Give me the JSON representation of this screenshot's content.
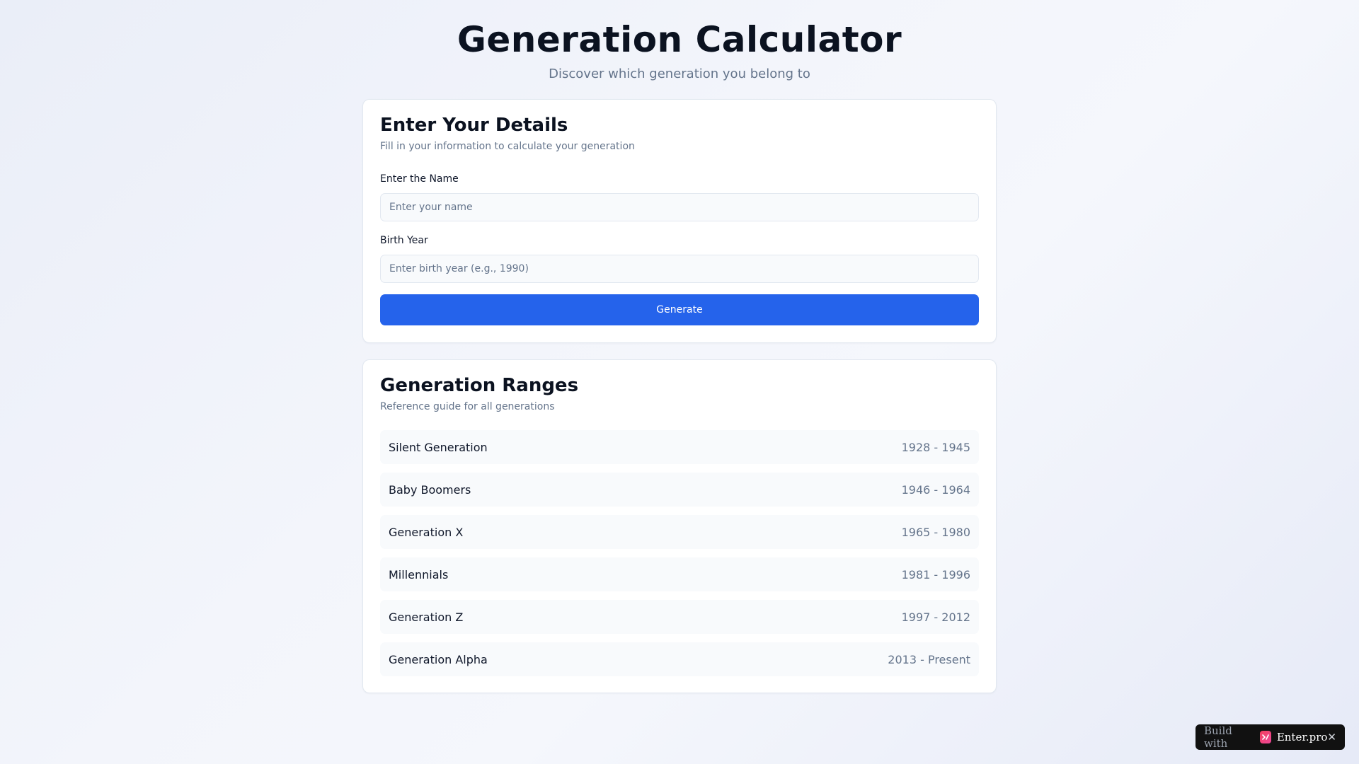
{
  "header": {
    "title": "Generation Calculator",
    "subtitle": "Discover which generation you belong to"
  },
  "details_card": {
    "title": "Enter Your Details",
    "description": "Fill in your information to calculate your generation",
    "name_label": "Enter the Name",
    "name_placeholder": "Enter your name",
    "name_value": "",
    "year_label": "Birth Year",
    "year_placeholder": "Enter birth year (e.g., 1990)",
    "year_value": "",
    "button_label": "Generate"
  },
  "ranges_card": {
    "title": "Generation Ranges",
    "description": "Reference guide for all generations",
    "items": [
      {
        "name": "Silent Generation",
        "years": "1928 - 1945"
      },
      {
        "name": "Baby Boomers",
        "years": "1946 - 1964"
      },
      {
        "name": "Generation X",
        "years": "1965 - 1980"
      },
      {
        "name": "Millennials",
        "years": "1981 - 1996"
      },
      {
        "name": "Generation Z",
        "years": "1997 - 2012"
      },
      {
        "name": "Generation Alpha",
        "years": "2013 - Present"
      }
    ]
  },
  "badge": {
    "prefix": "Build with",
    "brand": "Enter.pro",
    "logo_icon": "enter-logo-icon",
    "close_icon": "close-icon"
  },
  "colors": {
    "primary": "#2563eb",
    "muted_text": "#64748b",
    "background": "#f3f5fb",
    "badge_bg": "#111111"
  }
}
